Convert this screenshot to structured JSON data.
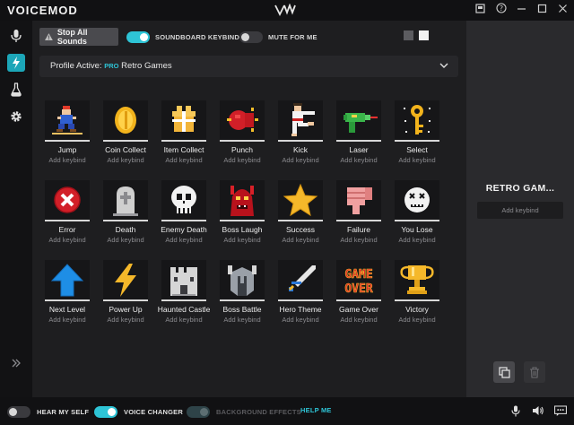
{
  "app": {
    "title": "VOICEMOD"
  },
  "window_controls": [
    "square-icon",
    "help-icon",
    "minimize-icon",
    "maximize-icon",
    "close-icon"
  ],
  "sidebar": {
    "items": [
      {
        "icon": "microphone-icon",
        "active": false
      },
      {
        "icon": "lightning-icon",
        "active": true
      },
      {
        "icon": "flask-icon",
        "active": false
      },
      {
        "icon": "gear-icon",
        "active": false
      }
    ],
    "expand_icon": "double-chevron-right-icon"
  },
  "toolbar": {
    "stop_all": "Stop All Sounds",
    "soundboard_keybinds": {
      "label": "SOUNDBOARD KEYBINDS",
      "on": true
    },
    "mute_for_me": {
      "label": "MUTE FOR ME",
      "on": false
    }
  },
  "profile": {
    "label": "Profile Active:",
    "badge": "PRO",
    "name": "Retro Games"
  },
  "sounds": [
    {
      "name": "Jump",
      "keybind": "Add keybind",
      "icon": "runner"
    },
    {
      "name": "Coin Collect",
      "keybind": "Add keybind",
      "icon": "coin"
    },
    {
      "name": "Item Collect",
      "keybind": "Add keybind",
      "icon": "gift"
    },
    {
      "name": "Punch",
      "keybind": "Add keybind",
      "icon": "glove"
    },
    {
      "name": "Kick",
      "keybind": "Add keybind",
      "icon": "fighter"
    },
    {
      "name": "Laser",
      "keybind": "Add keybind",
      "icon": "raygun"
    },
    {
      "name": "Select",
      "keybind": "Add keybind",
      "icon": "key"
    },
    {
      "name": "Error",
      "keybind": "Add keybind",
      "icon": "x-circle"
    },
    {
      "name": "Death",
      "keybind": "Add keybind",
      "icon": "tombstone"
    },
    {
      "name": "Enemy Death",
      "keybind": "Add keybind",
      "icon": "skull"
    },
    {
      "name": "Boss Laugh",
      "keybind": "Add keybind",
      "icon": "devil"
    },
    {
      "name": "Success",
      "keybind": "Add keybind",
      "icon": "star"
    },
    {
      "name": "Failure",
      "keybind": "Add keybind",
      "icon": "thumbs-down"
    },
    {
      "name": "You Lose",
      "keybind": "Add keybind",
      "icon": "dead-face"
    },
    {
      "name": "Next Level",
      "keybind": "Add keybind",
      "icon": "arrow-up"
    },
    {
      "name": "Power Up",
      "keybind": "Add keybind",
      "icon": "bolt"
    },
    {
      "name": "Haunted Castle",
      "keybind": "Add keybind",
      "icon": "castle"
    },
    {
      "name": "Boss Battle",
      "keybind": "Add keybind",
      "icon": "helmet"
    },
    {
      "name": "Hero Theme",
      "keybind": "Add keybind",
      "icon": "sword"
    },
    {
      "name": "Game Over",
      "keybind": "Add keybind",
      "icon": "game-over"
    },
    {
      "name": "Victory",
      "keybind": "Add keybind",
      "icon": "trophy"
    }
  ],
  "game_over_text": [
    "GAME",
    "OVER"
  ],
  "side_panel": {
    "title": "RETRO GAM...",
    "keybind": "Add keybind",
    "buttons": [
      "duplicate-icon",
      "trash-icon"
    ]
  },
  "bottom_bar": {
    "hear_myself": {
      "label": "HEAR MY SELF",
      "on": false
    },
    "voice_changer": {
      "label": "VOICE CHANGER",
      "on": true
    },
    "background_effects": {
      "label": "BACKGROUND EFFECTS",
      "on": true,
      "enabled": false
    },
    "help": "HELP ME",
    "icons": [
      "microphone-icon",
      "speaker-icon",
      "feedback-icon"
    ]
  },
  "colors": {
    "accent": "#2ec4d6",
    "background": "#1e1e20",
    "panel": "#2a2a2d"
  }
}
